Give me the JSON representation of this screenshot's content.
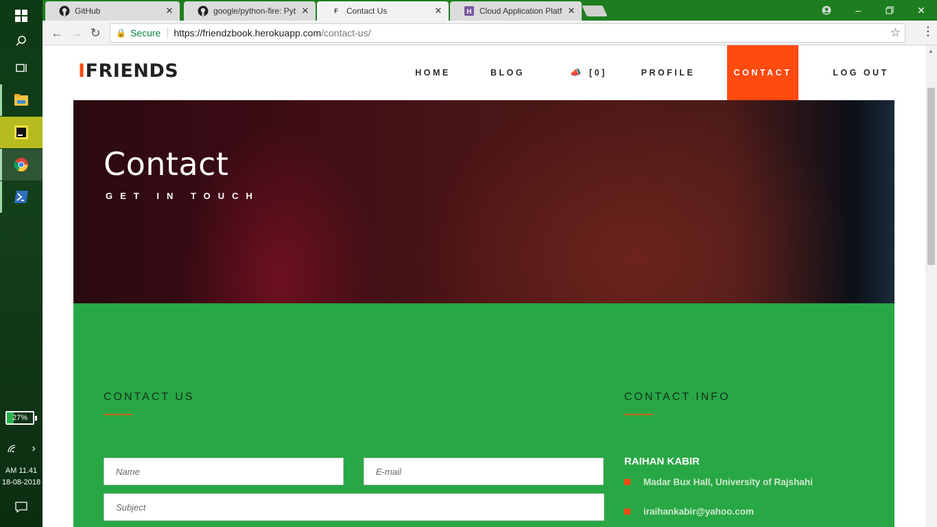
{
  "taskbar": {
    "battery_percent": "27%",
    "time": "AM 11.41",
    "date": "18-08-2018"
  },
  "browser": {
    "tabs": [
      {
        "title": "GitHub",
        "favicon": "github-icon"
      },
      {
        "title": "google/python-fire: Pyth",
        "favicon": "github-icon"
      },
      {
        "title": "Contact Us",
        "favicon": "friends-icon"
      },
      {
        "title": "Cloud Application Platfor",
        "favicon": "heroku-icon"
      }
    ],
    "secure_label": "Secure",
    "url_host": "https://friendzbook.herokuapp.com",
    "url_path": "/contact-us/"
  },
  "site": {
    "logo_mark": "I",
    "logo_text": "FRIENDS",
    "nav": {
      "home": "HOME",
      "blog": "BLOG",
      "notifications": "[0]",
      "profile": "PROFILE",
      "contact": "CONTACT",
      "logout": "LOG OUT"
    },
    "accent_color": "#ff4a10",
    "section_color": "#28a745"
  },
  "hero": {
    "title": "Contact",
    "subtitle": "GET IN TOUCH"
  },
  "contact_form": {
    "heading": "CONTACT US",
    "name_placeholder": "Name",
    "email_placeholder": "E-mail",
    "subject_placeholder": "Subject"
  },
  "contact_info": {
    "heading": "CONTACT INFO",
    "name": "RAIHAN KABIR",
    "address": "Madar Bux Hall, University of Rajshahi",
    "email": "iraihankabir@yahoo.com"
  }
}
